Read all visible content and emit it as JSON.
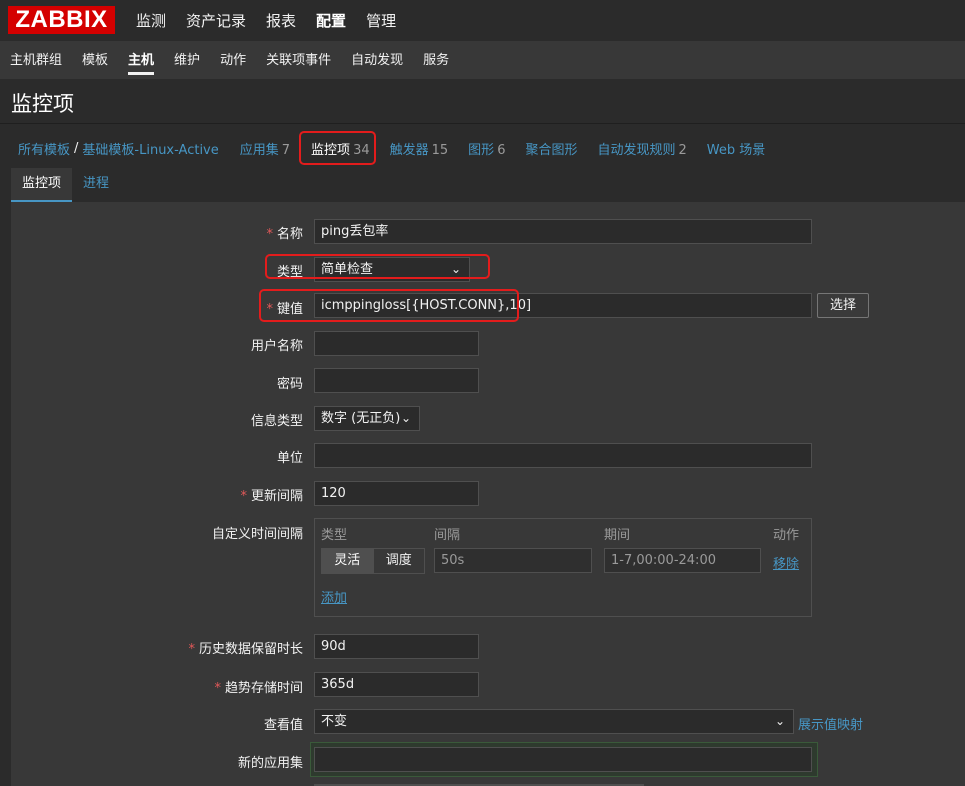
{
  "logo": "ZABBIX",
  "main_menu": [
    {
      "label": "监测",
      "active": false
    },
    {
      "label": "资产记录",
      "active": false
    },
    {
      "label": "报表",
      "active": false
    },
    {
      "label": "配置",
      "active": true
    },
    {
      "label": "管理",
      "active": false
    }
  ],
  "sub_menu": [
    {
      "label": "主机群组",
      "active": false
    },
    {
      "label": "模板",
      "active": false
    },
    {
      "label": "主机",
      "active": true
    },
    {
      "label": "维护",
      "active": false
    },
    {
      "label": "动作",
      "active": false
    },
    {
      "label": "关联项事件",
      "active": false
    },
    {
      "label": "自动发现",
      "active": false
    },
    {
      "label": "服务",
      "active": false
    }
  ],
  "page_title": "监控项",
  "breadcrumb": {
    "all_templates": "所有模板",
    "template": "基础模板-Linux-Active",
    "tabs": [
      {
        "label": "应用集",
        "count": "7"
      },
      {
        "label": "监控项",
        "count": "34"
      },
      {
        "label": "触发器",
        "count": "15"
      },
      {
        "label": "图形",
        "count": "6"
      },
      {
        "label": "聚合图形",
        "count": ""
      },
      {
        "label": "自动发现规则",
        "count": "2"
      },
      {
        "label": "Web 场景",
        "count": ""
      }
    ]
  },
  "form_tabs": [
    "监控项",
    "进程"
  ],
  "form": {
    "name": {
      "label": "名称",
      "value": "ping丢包率"
    },
    "type": {
      "label": "类型",
      "value": "简单检查"
    },
    "key": {
      "label": "键值",
      "value": "icmppingloss[{HOST.CONN},10]",
      "select_button": "选择"
    },
    "username": {
      "label": "用户名称",
      "value": ""
    },
    "password": {
      "label": "密码",
      "value": ""
    },
    "info_type": {
      "label": "信息类型",
      "value": "数字 (无正负)"
    },
    "units": {
      "label": "单位",
      "value": ""
    },
    "update_interval": {
      "label": "更新间隔",
      "value": "120"
    },
    "custom_intervals": {
      "label": "自定义时间间隔",
      "headers": {
        "type": "类型",
        "interval": "间隔",
        "period": "期间",
        "action": "动作"
      },
      "type_flexible": "灵活",
      "type_scheduling": "调度",
      "interval_value": "50s",
      "period_value": "1-7,00:00-24:00",
      "remove": "移除",
      "add": "添加"
    },
    "history": {
      "label": "历史数据保留时长",
      "value": "90d"
    },
    "trends": {
      "label": "趋势存储时间",
      "value": "365d"
    },
    "show_value": {
      "label": "查看值",
      "value": "不变",
      "link": "展示值映射"
    },
    "new_application": {
      "label": "新的应用集",
      "value": ""
    }
  },
  "colors": {
    "accent": "#4796c4",
    "highlight": "#e31c1c",
    "logo_bg": "#d40000",
    "required": "#e45959"
  }
}
